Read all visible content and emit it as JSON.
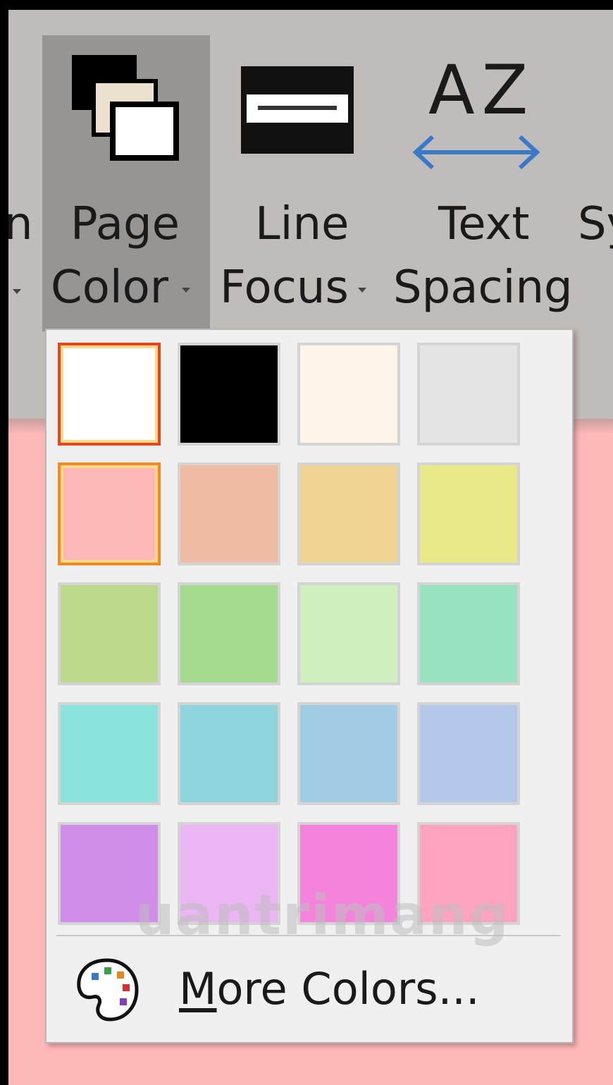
{
  "ribbon": {
    "partial_left_label": "n",
    "page_color": {
      "line1": "Page",
      "line2": "Color"
    },
    "line_focus": {
      "line1": "Line",
      "line2": "Focus"
    },
    "text_spacing": {
      "icon_text": "AZ",
      "line1": "Text",
      "line2": "Spacing"
    },
    "partial_right_label": "Sy"
  },
  "dropdown": {
    "swatches": [
      {
        "color": "#ffffff",
        "state": "selected"
      },
      {
        "color": "#000000"
      },
      {
        "color": "#fdf5e9"
      },
      {
        "color": "#e5e5e5"
      },
      {
        "color": "#ffb8b8",
        "state": "hover"
      },
      {
        "color": "#eebba3"
      },
      {
        "color": "#efd493"
      },
      {
        "color": "#e9e989"
      },
      {
        "color": "#bcd88a"
      },
      {
        "color": "#a6da8e"
      },
      {
        "color": "#d0f0bf"
      },
      {
        "color": "#97e3bf"
      },
      {
        "color": "#8be3de"
      },
      {
        "color": "#8dd4dc"
      },
      {
        "color": "#a0cde3"
      },
      {
        "color": "#b4c8eb"
      },
      {
        "color": "#d08de9"
      },
      {
        "color": "#ebb6f3"
      },
      {
        "color": "#f483dc"
      },
      {
        "color": "#fea4c0"
      }
    ],
    "more_colors": {
      "underlined_letter": "M",
      "rest": "ore Colors..."
    }
  },
  "watermark": "uantrimang"
}
